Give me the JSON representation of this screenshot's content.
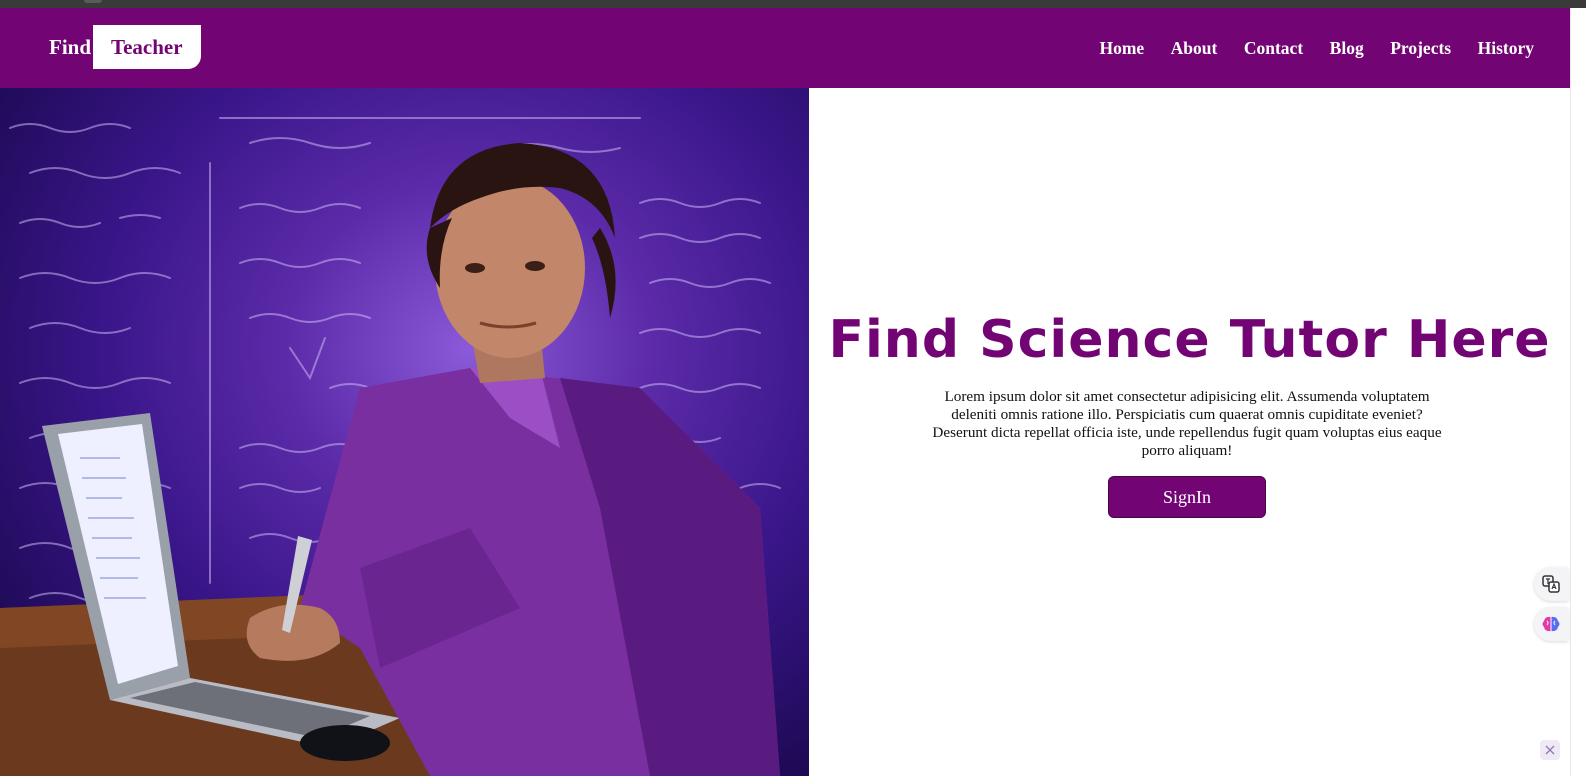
{
  "navbar": {
    "brand_find": "Find",
    "brand_teacher": "Teacher",
    "links": [
      "Home",
      "About",
      "Contact",
      "Blog",
      "Projects",
      "History"
    ],
    "background_color": "#720474"
  },
  "hero": {
    "image_description_icon": "tutor-with-laptop-image"
  },
  "main": {
    "headline": "Find Science Tutor Here",
    "blurb": "Lorem ipsum dolor sit amet consectetur adipisicing elit. Assumenda voluptatem deleniti omnis ratione illo. Perspiciatis cum quaerat omnis cupiditate eveniet? Deserunt dicta repellat officia iste, unde repellendus fugit quam voluptas eius eaque porro aliquam!",
    "signin_label": "SignIn",
    "accent_color": "#720474"
  },
  "side_widgets": {
    "icons": [
      "translate-icon",
      "brain-icon"
    ]
  }
}
